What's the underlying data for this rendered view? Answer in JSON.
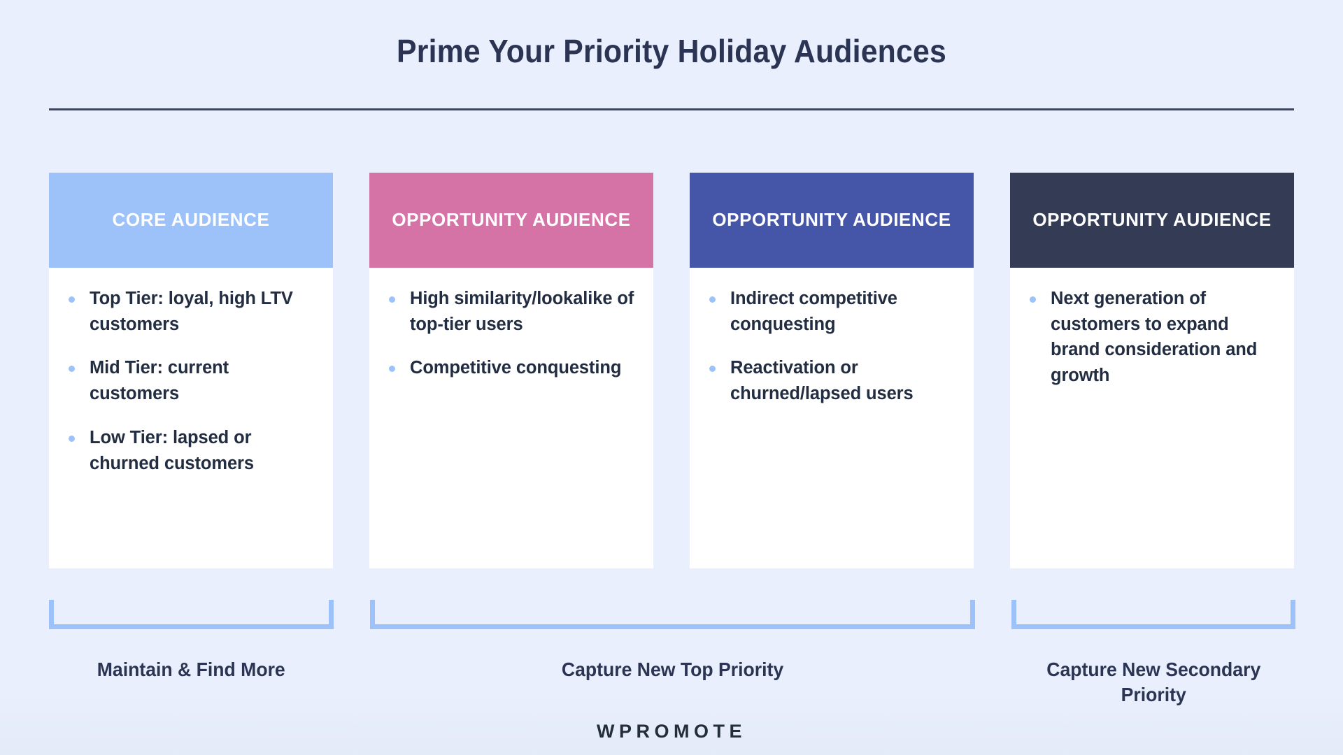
{
  "slide": {
    "title": "Prime Your Priority Holiday Audiences",
    "background_color": "#e8eefb",
    "title_color": "#2b3553",
    "rule_color": "#3c4765"
  },
  "cards": [
    {
      "header": "CORE AUDIENCE",
      "header_color": "#9dc2fa",
      "bullets": [
        "Top Tier: loyal, high LTV customers",
        "Mid Tier: current customers",
        "Low Tier: lapsed or churned customers"
      ]
    },
    {
      "header": "OPPORTUNITY AUDIENCE",
      "header_color": "#d673a6",
      "bullets": [
        "High similarity/lookalike of top-tier users",
        "Competitive conquesting"
      ]
    },
    {
      "header": "OPPORTUNITY AUDIENCE",
      "header_color": "#4555a8",
      "bullets": [
        "Indirect competitive conquesting",
        "Reactivation or churned/lapsed users"
      ]
    },
    {
      "header": "OPPORTUNITY AUDIENCE",
      "header_color": "#343b55",
      "bullets": [
        "Next generation of customers to expand brand consideration and growth"
      ]
    }
  ],
  "groups": [
    {
      "label": "Maintain & Find More",
      "spans": 1
    },
    {
      "label": "Capture New Top Priority",
      "spans": 2
    },
    {
      "label": "Capture New Secondary Priority",
      "spans": 1
    }
  ],
  "bracket_color": "#9dc2fa",
  "bullet_color": "#9dc2fa",
  "bullet_text_color": "#232d42",
  "logo": {
    "text": "WPROMOTE"
  }
}
